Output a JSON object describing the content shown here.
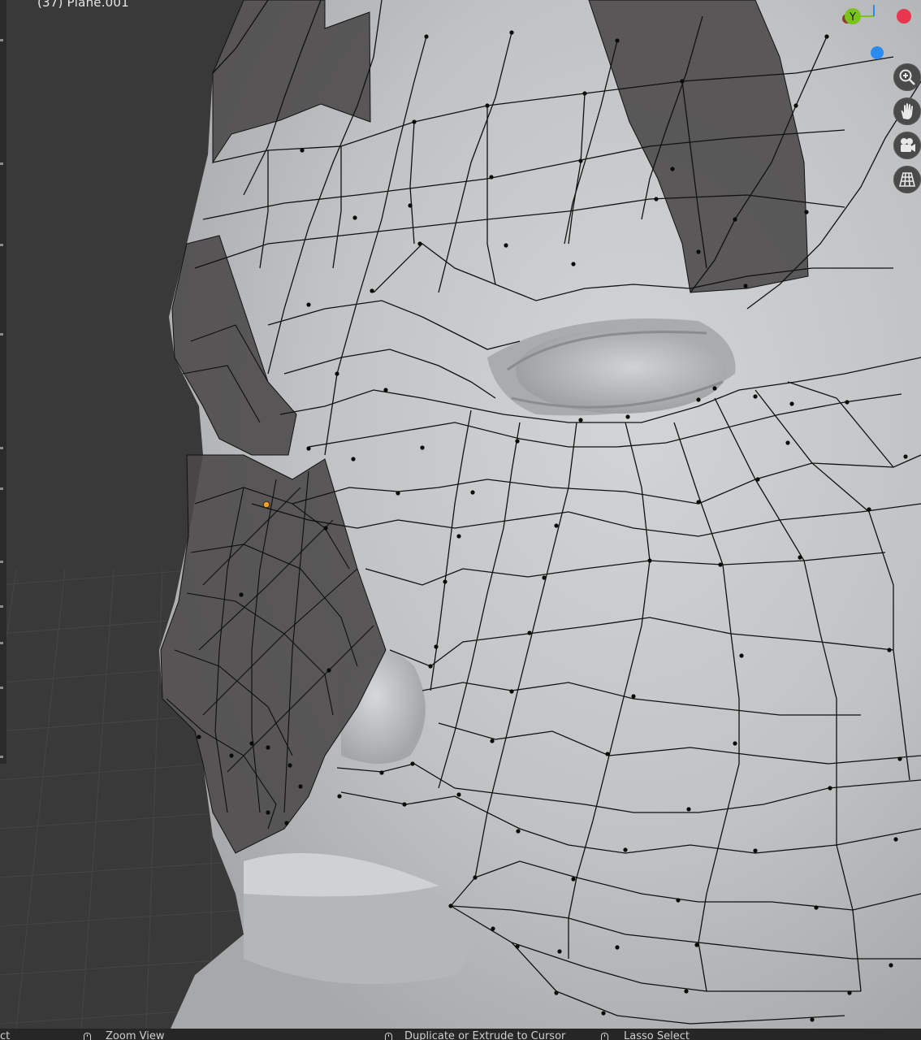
{
  "viewport": {
    "object_label": "(37) Plane.001",
    "background_color": "#393939",
    "mesh_color": "#c4c6c8",
    "wire_color": "#111111",
    "overlay_color": "#4a4848",
    "active_vertex_color": "#f0a030"
  },
  "gizmo": {
    "y_axis_label": "Y",
    "y_color": "#7ac31d",
    "x_color": "#e8364e",
    "z_color": "#2a8cf0"
  },
  "nav_tools": [
    {
      "name": "zoom-icon"
    },
    {
      "name": "hand-pan-icon"
    },
    {
      "name": "camera-icon"
    },
    {
      "name": "perspective-grid-icon"
    }
  ],
  "statusbar": {
    "left_fragment": "ct",
    "zoom_label": "Zoom View",
    "duplicate_label": "Duplicate or Extrude to Cursor",
    "lasso_label": "Lasso Select"
  }
}
